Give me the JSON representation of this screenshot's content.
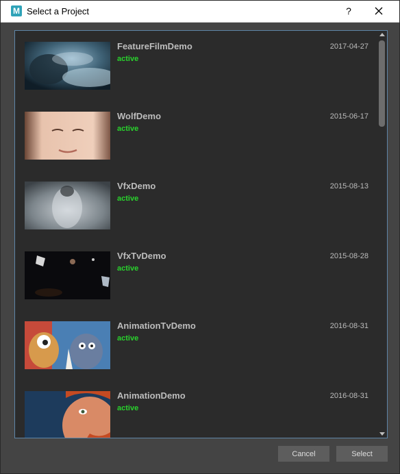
{
  "window": {
    "title": "Select a Project",
    "app_icon_letter": "M",
    "help_label": "?"
  },
  "projects": [
    {
      "name": "FeatureFilmDemo",
      "status": "active",
      "date": "2017-04-27",
      "thumbnail_icon": "storm-clouds-thumbnail"
    },
    {
      "name": "WolfDemo",
      "status": "active",
      "date": "2015-06-17",
      "thumbnail_icon": "face-thumbnail"
    },
    {
      "name": "VfxDemo",
      "status": "active",
      "date": "2015-08-13",
      "thumbnail_icon": "wolf-fur-thumbnail"
    },
    {
      "name": "VfxTvDemo",
      "status": "active",
      "date": "2015-08-28",
      "thumbnail_icon": "space-thumbnail"
    },
    {
      "name": "AnimationTvDemo",
      "status": "active",
      "date": "2016-08-31",
      "thumbnail_icon": "cartoon-characters-thumbnail"
    },
    {
      "name": "AnimationDemo",
      "status": "active",
      "date": "2016-08-31",
      "thumbnail_icon": "character-face-thumbnail"
    }
  ],
  "buttons": {
    "cancel": "Cancel",
    "select": "Select"
  },
  "colors": {
    "status_active": "#29d42d",
    "list_border": "#5e86a8",
    "panel_bg": "#2b2b2b",
    "window_bg": "#444444"
  }
}
